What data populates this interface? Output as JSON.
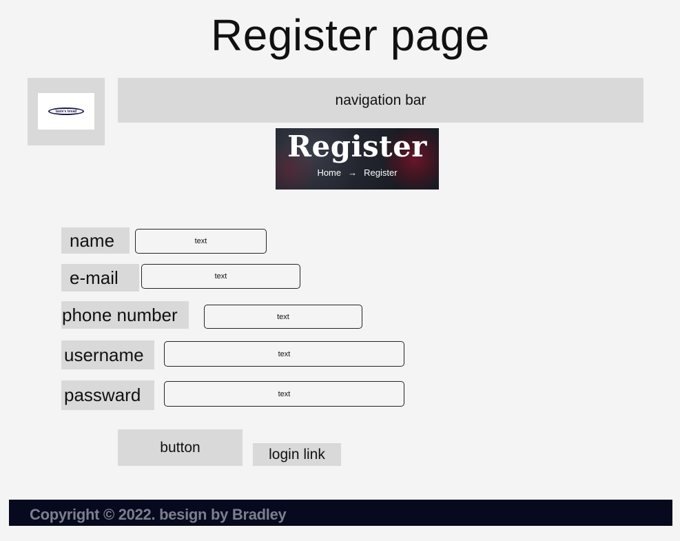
{
  "page": {
    "title": "Register page"
  },
  "logo": {
    "text": "taste's bread"
  },
  "nav": {
    "label": "navigation bar"
  },
  "banner": {
    "title": "Register",
    "crumb_home": "Home",
    "crumb_arrow": "→",
    "crumb_current": "Register"
  },
  "form": {
    "fields": [
      {
        "label": "name",
        "value": "text"
      },
      {
        "label": "e-mail",
        "value": "text"
      },
      {
        "label": "phone number",
        "value": "text"
      },
      {
        "label": "username",
        "value": "text"
      },
      {
        "label": "passward",
        "value": "text"
      }
    ],
    "button_label": "button",
    "login_link": "login link"
  },
  "footer": {
    "text": "Copyright © 2022. besign by Bradley"
  }
}
